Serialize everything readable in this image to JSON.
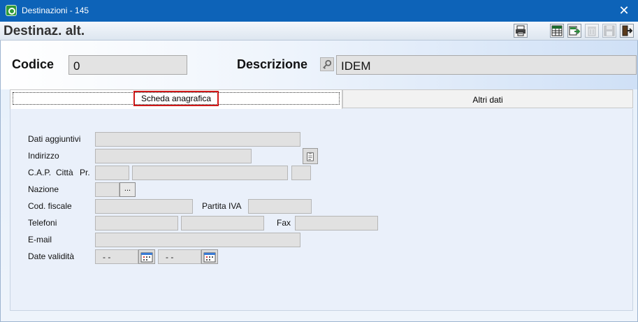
{
  "window": {
    "title": "Destinazioni - 145",
    "close_glyph": "✕"
  },
  "form": {
    "title": "Destinaz. alt."
  },
  "toolbar": {
    "buttons": [
      {
        "name": "print-icon",
        "enabled": true
      },
      {
        "name": "spreadsheet-icon",
        "enabled": true
      },
      {
        "name": "export-icon",
        "enabled": true
      },
      {
        "name": "delete-icon",
        "enabled": false
      },
      {
        "name": "save-icon",
        "enabled": false
      },
      {
        "name": "exit-icon",
        "enabled": true
      }
    ]
  },
  "header": {
    "codice_label": "Codice",
    "codice_value": "0",
    "descrizione_label": "Descrizione",
    "descrizione_value": "IDEM"
  },
  "tabs": [
    {
      "label": "Scheda anagrafica",
      "active": true
    },
    {
      "label": "Altri dati",
      "active": false
    }
  ],
  "fields": {
    "dati_aggiuntivi": {
      "label": "Dati aggiuntivi",
      "value": ""
    },
    "indirizzo": {
      "label": "Indirizzo",
      "value": ""
    },
    "cap_label": "C.A.P.",
    "citta_label": "Città",
    "pr_label": "Pr.",
    "cap": "",
    "citta": "",
    "provincia": "",
    "nazione": {
      "label": "Nazione",
      "value": "",
      "lookup_button": "..."
    },
    "codice_fiscale": {
      "label": "Cod. fiscale",
      "value": ""
    },
    "partita_iva": {
      "label": "Partita IVA",
      "value": ""
    },
    "telefoni": {
      "label": "Telefoni",
      "value1": "",
      "value2": ""
    },
    "fax": {
      "label": "Fax",
      "value": ""
    },
    "email": {
      "label": "E-mail",
      "value": ""
    },
    "date_validita": {
      "label": "Date validità",
      "from": "- -",
      "to": "- -"
    }
  }
}
